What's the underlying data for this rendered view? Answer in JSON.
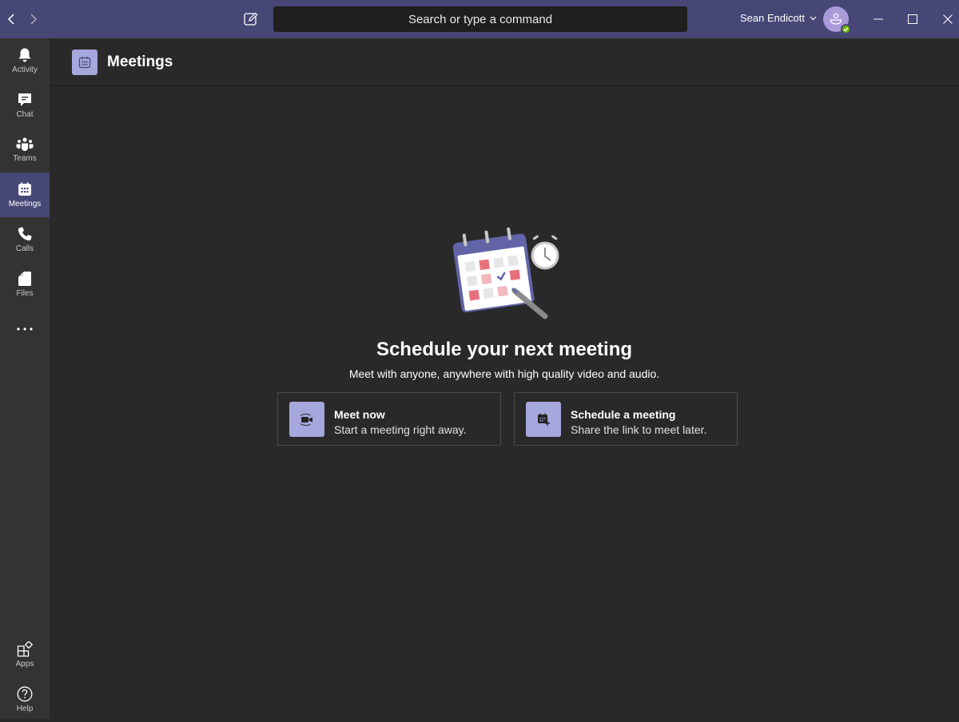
{
  "titlebar": {
    "search_placeholder": "Search or type a command",
    "user_name": "Sean Endicott",
    "presence_status": "available",
    "accent_color": "#464775"
  },
  "rail": {
    "items": [
      {
        "label": "Activity",
        "icon": "bell-icon"
      },
      {
        "label": "Chat",
        "icon": "chat-icon"
      },
      {
        "label": "Teams",
        "icon": "teams-icon"
      },
      {
        "label": "Meetings",
        "icon": "calendar-icon",
        "active": true
      },
      {
        "label": "Calls",
        "icon": "phone-icon"
      },
      {
        "label": "Files",
        "icon": "file-icon"
      }
    ],
    "more_label": "More apps",
    "bottom_items": [
      {
        "label": "Apps",
        "icon": "apps-icon"
      },
      {
        "label": "Help",
        "icon": "help-icon"
      }
    ]
  },
  "header": {
    "title": "Meetings"
  },
  "empty_state": {
    "headline": "Schedule your next meeting",
    "subline": "Meet with anyone, anywhere with high quality video and audio."
  },
  "actions": [
    {
      "title": "Meet now",
      "description": "Start a meeting right away."
    },
    {
      "title": "Schedule a meeting",
      "description": "Share the link to meet later."
    }
  ]
}
